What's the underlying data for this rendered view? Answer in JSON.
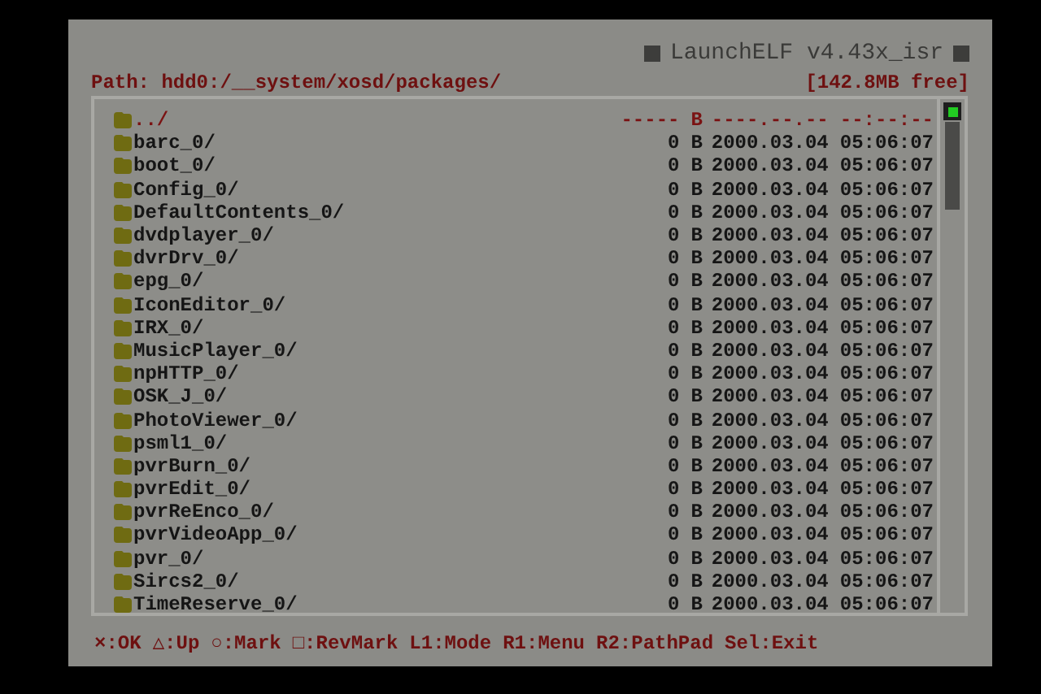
{
  "title": "LaunchELF v4.43x_isr",
  "path": "Path: hdd0:/__system/xosd/packages/",
  "free": "[142.8MB free]",
  "rows": [
    {
      "kind": "parent",
      "name": "../",
      "size": "-----",
      "unit": "B",
      "date": "----.--.--",
      "time": "--:--:--"
    },
    {
      "kind": "folder",
      "name": "barc_0/",
      "size": "0",
      "unit": "B",
      "date": "2000.03.04",
      "time": "05:06:07"
    },
    {
      "kind": "folder",
      "name": "boot_0/",
      "size": "0",
      "unit": "B",
      "date": "2000.03.04",
      "time": "05:06:07"
    },
    {
      "kind": "folder",
      "name": "Config_0/",
      "size": "0",
      "unit": "B",
      "date": "2000.03.04",
      "time": "05:06:07"
    },
    {
      "kind": "folder",
      "name": "DefaultContents_0/",
      "size": "0",
      "unit": "B",
      "date": "2000.03.04",
      "time": "05:06:07"
    },
    {
      "kind": "folder",
      "name": "dvdplayer_0/",
      "size": "0",
      "unit": "B",
      "date": "2000.03.04",
      "time": "05:06:07"
    },
    {
      "kind": "folder",
      "name": "dvrDrv_0/",
      "size": "0",
      "unit": "B",
      "date": "2000.03.04",
      "time": "05:06:07"
    },
    {
      "kind": "folder",
      "name": "epg_0/",
      "size": "0",
      "unit": "B",
      "date": "2000.03.04",
      "time": "05:06:07"
    },
    {
      "kind": "folder",
      "name": "IconEditor_0/",
      "size": "0",
      "unit": "B",
      "date": "2000.03.04",
      "time": "05:06:07"
    },
    {
      "kind": "folder",
      "name": "IRX_0/",
      "size": "0",
      "unit": "B",
      "date": "2000.03.04",
      "time": "05:06:07"
    },
    {
      "kind": "folder",
      "name": "MusicPlayer_0/",
      "size": "0",
      "unit": "B",
      "date": "2000.03.04",
      "time": "05:06:07"
    },
    {
      "kind": "folder",
      "name": "npHTTP_0/",
      "size": "0",
      "unit": "B",
      "date": "2000.03.04",
      "time": "05:06:07"
    },
    {
      "kind": "folder",
      "name": "OSK_J_0/",
      "size": "0",
      "unit": "B",
      "date": "2000.03.04",
      "time": "05:06:07"
    },
    {
      "kind": "folder",
      "name": "PhotoViewer_0/",
      "size": "0",
      "unit": "B",
      "date": "2000.03.04",
      "time": "05:06:07"
    },
    {
      "kind": "folder",
      "name": "psml1_0/",
      "size": "0",
      "unit": "B",
      "date": "2000.03.04",
      "time": "05:06:07"
    },
    {
      "kind": "folder",
      "name": "pvrBurn_0/",
      "size": "0",
      "unit": "B",
      "date": "2000.03.04",
      "time": "05:06:07"
    },
    {
      "kind": "folder",
      "name": "pvrEdit_0/",
      "size": "0",
      "unit": "B",
      "date": "2000.03.04",
      "time": "05:06:07"
    },
    {
      "kind": "folder",
      "name": "pvrReEnco_0/",
      "size": "0",
      "unit": "B",
      "date": "2000.03.04",
      "time": "05:06:07"
    },
    {
      "kind": "folder",
      "name": "pvrVideoApp_0/",
      "size": "0",
      "unit": "B",
      "date": "2000.03.04",
      "time": "05:06:07"
    },
    {
      "kind": "folder",
      "name": "pvr_0/",
      "size": "0",
      "unit": "B",
      "date": "2000.03.04",
      "time": "05:06:07"
    },
    {
      "kind": "folder",
      "name": "Sircs2_0/",
      "size": "0",
      "unit": "B",
      "date": "2000.03.04",
      "time": "05:06:07"
    },
    {
      "kind": "folder",
      "name": "TimeReserve_0/",
      "size": "0",
      "unit": "B",
      "date": "2000.03.04",
      "time": "05:06:07"
    }
  ],
  "footer": [
    "×:OK",
    "△:Up",
    "○:Mark",
    "□:RevMark",
    "L1:Mode",
    "R1:Menu",
    "R2:PathPad",
    "Sel:Exit"
  ]
}
